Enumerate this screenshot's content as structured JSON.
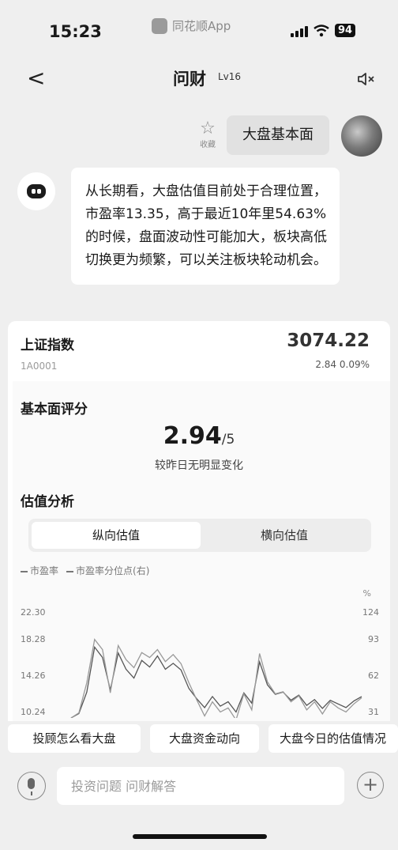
{
  "status_bar": {
    "time": "15:23",
    "source_app": "同花顺App",
    "battery": "94"
  },
  "nav": {
    "back": "<",
    "title": "问财",
    "level": "Lv16",
    "mute_icon": "speaker-mute-icon"
  },
  "conversation": {
    "favorite_label": "收藏",
    "question": "大盘基本面",
    "answer": "从长期看，大盘估值目前处于合理位置，市盈率13.35，高于最近10年里54.63%的时候，盘面波动性可能加大，板块高低切换更为频繁，可以关注板块轮动机会。"
  },
  "index_card": {
    "name": "上证指数",
    "code": "1A0001",
    "price": "3074.22",
    "change": "2.84 0.09%",
    "fundamentals": {
      "title": "基本面评分",
      "score": "2.94",
      "score_max": "/5",
      "note": "较昨日无明显变化"
    },
    "valuation": {
      "title": "估值分析",
      "tabs": [
        "纵向估值",
        "横向估值"
      ],
      "active_tab": 0
    }
  },
  "chart_data": {
    "type": "line",
    "legend": [
      "市盈率",
      "市盈率分位点(右)"
    ],
    "right_unit": "%",
    "left_ticks": [
      "22.30",
      "18.28",
      "14.26",
      "10.24"
    ],
    "right_ticks": [
      "124",
      "93",
      "62",
      "31"
    ],
    "series": [
      {
        "name": "市盈率",
        "values": [
          9.0,
          9.6,
          12.5,
          18.6,
          17.2,
          12.8,
          17.8,
          15.6,
          14.4,
          16.8,
          15.9,
          17.4,
          15.6,
          16.4,
          15.5,
          13.0,
          11.6,
          10.4,
          11.9,
          10.6,
          11.2,
          9.8,
          12.4,
          11.0,
          16.6,
          13.5,
          12.2,
          12.5,
          11.4,
          12.1,
          10.7,
          11.5,
          10.3,
          11.4,
          10.9,
          10.4,
          11.3,
          11.9
        ]
      },
      {
        "name": "市盈率分位点(右)",
        "values": [
          20,
          25,
          55,
          98,
          88,
          45,
          92,
          78,
          70,
          85,
          80,
          88,
          76,
          83,
          74,
          55,
          38,
          22,
          36,
          26,
          30,
          18,
          44,
          28,
          84,
          56,
          44,
          46,
          36,
          42,
          28,
          36,
          24,
          36,
          30,
          26,
          34,
          40
        ]
      }
    ],
    "y_left_range": [
      9.0,
      24.0
    ],
    "y_right_range": [
      20,
      130
    ]
  },
  "quick_questions": [
    "投顾怎么看大盘",
    "大盘资金动向",
    "大盘今日的估值情况"
  ],
  "input": {
    "placeholder": "投资问题 问财解答"
  }
}
